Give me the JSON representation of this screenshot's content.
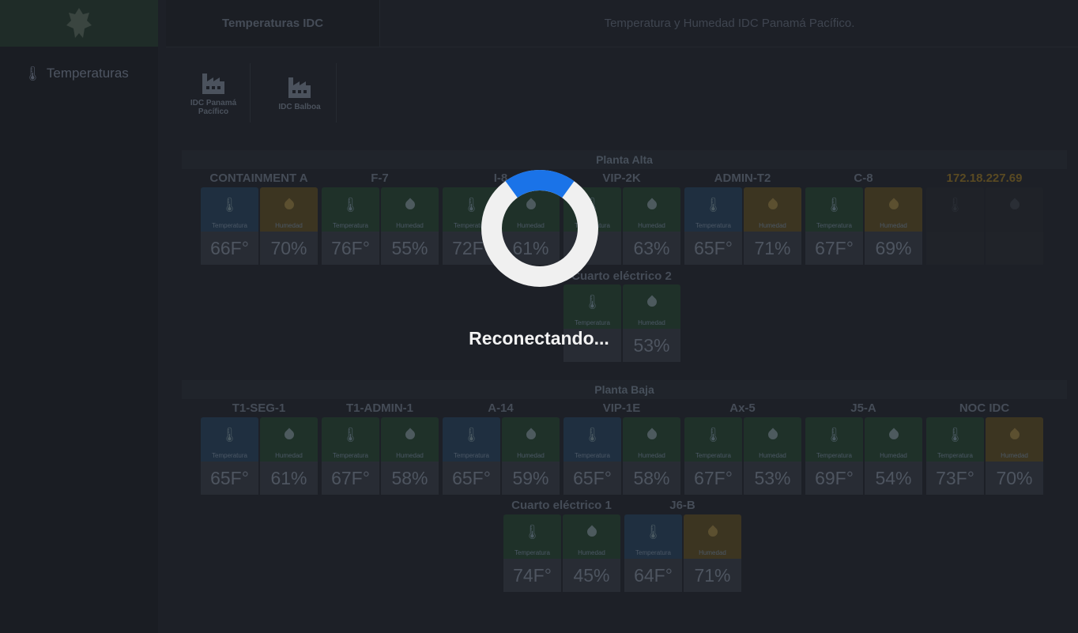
{
  "sidebar": {
    "nav_temperaturas": "Temperaturas"
  },
  "header": {
    "tab_label": "Temperaturas IDC",
    "title": "Temperatura y Humedad IDC Panamá Pacífico."
  },
  "sites": [
    {
      "label_line1": "IDC Panamá",
      "label_line2": "Pacífico"
    },
    {
      "label_line1": "IDC Balboa",
      "label_line2": ""
    }
  ],
  "labels": {
    "temperatura": "Temperatura",
    "humedad": "Humedad"
  },
  "planta_alta": {
    "title": "Planta Alta",
    "rooms": [
      {
        "name": "CONTAINMENT A",
        "temp": "66F°",
        "hum": "70%"
      },
      {
        "name": "F-7",
        "temp": "76F°",
        "hum": "55%"
      },
      {
        "name": "I-8",
        "temp": "72F°",
        "hum": "61%"
      },
      {
        "name": "VIP-2K",
        "temp": "",
        "hum": "63%"
      },
      {
        "name": "ADMIN-T2",
        "temp": "65F°",
        "hum": "71%"
      },
      {
        "name": "C-8",
        "temp": "67F°",
        "hum": "69%"
      },
      {
        "name": "172.18.227.69",
        "temp": "",
        "hum": ""
      }
    ],
    "second_row": [
      {
        "name": "Cuarto eléctrico 2",
        "temp": "",
        "hum": "53%"
      }
    ]
  },
  "planta_baja": {
    "title": "Planta Baja",
    "rooms": [
      {
        "name": "T1-SEG-1",
        "temp": "65F°",
        "hum": "61%"
      },
      {
        "name": "T1-ADMIN-1",
        "temp": "67F°",
        "hum": "58%"
      },
      {
        "name": "A-14",
        "temp": "65F°",
        "hum": "59%"
      },
      {
        "name": "VIP-1E",
        "temp": "65F°",
        "hum": "58%"
      },
      {
        "name": "Ax-5",
        "temp": "67F°",
        "hum": "53%"
      },
      {
        "name": "J5-A",
        "temp": "69F°",
        "hum": "54%"
      },
      {
        "name": "NOC IDC",
        "temp": "73F°",
        "hum": "70%"
      }
    ],
    "second_row": [
      {
        "name": "Cuarto eléctrico 1",
        "temp": "74F°",
        "hum": "45%"
      },
      {
        "name": "J6-B",
        "temp": "64F°",
        "hum": "71%"
      }
    ]
  },
  "overlay": {
    "text": "Reconectando...",
    "spinner_progress": 0.2
  },
  "colors": {
    "temp_tile": "#1f2f40",
    "ok_tile": "#1f3129",
    "warn_tile": "#3c3521",
    "spinner_accent": "#1a73e8",
    "ip_text": "#5a4a22"
  }
}
